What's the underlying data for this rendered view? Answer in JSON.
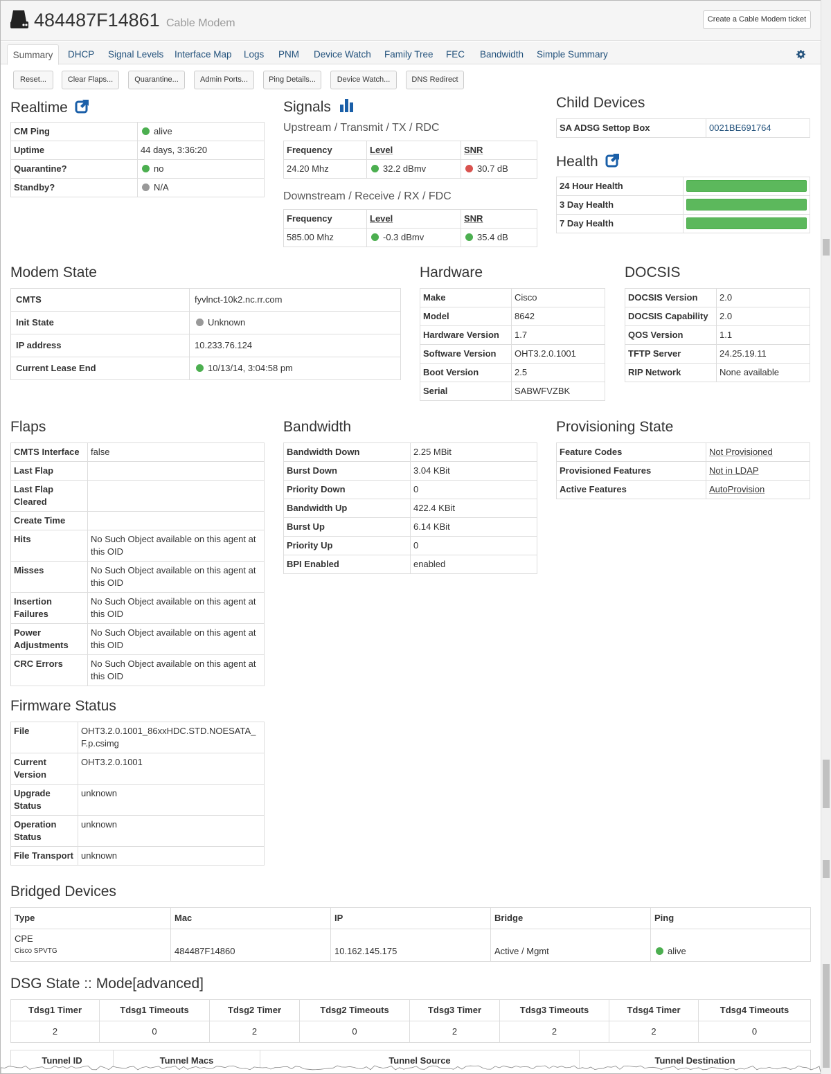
{
  "header": {
    "device_id": "484487F14861",
    "device_type": "Cable Modem",
    "ticket_button": "Create a Cable Modem ticket"
  },
  "tabs": [
    "Summary",
    "DHCP",
    "Signal Levels",
    "Interface Map",
    "Logs",
    "PNM",
    "Device Watch",
    "Family Tree",
    "FEC",
    "Bandwidth",
    "Simple Summary"
  ],
  "actions": [
    "Reset...",
    "Clear Flaps...",
    "Quarantine...",
    "Admin Ports...",
    "Ping Details...",
    "Device Watch...",
    "DNS Redirect"
  ],
  "realtime": {
    "title": "Realtime",
    "rows": [
      [
        "CM Ping",
        "alive"
      ],
      [
        "Uptime",
        "44 days, 3:36:20"
      ],
      [
        "Quarantine?",
        "no"
      ],
      [
        "Standby?",
        "N/A"
      ]
    ]
  },
  "signals": {
    "title": "Signals",
    "upstream_title": "Upstream / Transmit / TX / RDC",
    "downstream_title": "Downstream / Receive / RX / FDC",
    "cols": [
      "Frequency",
      "Level",
      "SNR"
    ],
    "up": [
      "24.20 Mhz",
      "32.2 dBmv",
      "30.7 dB"
    ],
    "down": [
      "585.00 Mhz",
      "-0.3 dBmv",
      "35.4 dB"
    ]
  },
  "child_devices": {
    "title": "Child Devices",
    "rows": [
      [
        "SA ADSG Settop Box",
        "0021BE691764"
      ]
    ]
  },
  "health": {
    "title": "Health",
    "rows": [
      {
        "label": "24 Hour Health",
        "pct": 100
      },
      {
        "label": "3 Day Health",
        "pct": 100
      },
      {
        "label": "7 Day Health",
        "pct": 100
      }
    ]
  },
  "modem_state": {
    "title": "Modem State",
    "rows": [
      [
        "CMTS",
        "fyvlnct-10k2.nc.rr.com"
      ],
      [
        "Init State",
        "Unknown"
      ],
      [
        "IP address",
        "10.233.76.124"
      ],
      [
        "Current Lease End",
        "10/13/14, 3:04:58 pm"
      ]
    ]
  },
  "hardware": {
    "title": "Hardware",
    "rows": [
      [
        "Make",
        "Cisco"
      ],
      [
        "Model",
        "8642"
      ],
      [
        "Hardware Version",
        "1.7"
      ],
      [
        "Software Version",
        "OHT3.2.0.1001"
      ],
      [
        "Boot Version",
        "2.5"
      ],
      [
        "Serial",
        "SABWFVZBK"
      ]
    ]
  },
  "docsis": {
    "title": "DOCSIS",
    "rows": [
      [
        "DOCSIS Version",
        "2.0"
      ],
      [
        "DOCSIS Capability",
        "2.0"
      ],
      [
        "QOS Version",
        "1.1"
      ],
      [
        "TFTP Server",
        "24.25.19.11"
      ],
      [
        "RIP Network",
        "None available"
      ]
    ]
  },
  "flaps": {
    "title": "Flaps",
    "rows": [
      [
        "CMTS Interface",
        "false"
      ],
      [
        "Last Flap",
        ""
      ],
      [
        "Last Flap Cleared",
        ""
      ],
      [
        "Create Time",
        ""
      ],
      [
        "Hits",
        "No Such Object available on this agent at this OID"
      ],
      [
        "Misses",
        "No Such Object available on this agent at this OID"
      ],
      [
        "Insertion Failures",
        "No Such Object available on this agent at this OID"
      ],
      [
        "Power Adjustments",
        "No Such Object available on this agent at this OID"
      ],
      [
        "CRC Errors",
        "No Such Object available on this agent at this OID"
      ]
    ]
  },
  "bandwidth": {
    "title": "Bandwidth",
    "rows": [
      [
        "Bandwidth Down",
        "2.25 MBit"
      ],
      [
        "Burst Down",
        "3.04 KBit"
      ],
      [
        "Priority Down",
        "0"
      ],
      [
        "Bandwidth Up",
        "422.4 KBit"
      ],
      [
        "Burst Up",
        "6.14 KBit"
      ],
      [
        "Priority Up",
        "0"
      ],
      [
        "BPI Enabled",
        "enabled"
      ]
    ]
  },
  "provisioning": {
    "title": "Provisioning State",
    "rows": [
      [
        "Feature Codes",
        "Not Provisioned"
      ],
      [
        "Provisioned Features",
        "Not in LDAP"
      ],
      [
        "Active Features",
        "AutoProvision"
      ]
    ]
  },
  "firmware": {
    "title": "Firmware Status",
    "rows": [
      [
        "File",
        "OHT3.2.0.1001_86xxHDC.STD.NOESATA_F.p.csimg"
      ],
      [
        "Current Version",
        "OHT3.2.0.1001"
      ],
      [
        "Upgrade Status",
        "unknown"
      ],
      [
        "Operation Status",
        "unknown"
      ],
      [
        "File Transport",
        "unknown"
      ]
    ]
  },
  "bridged": {
    "title": "Bridged Devices",
    "cols": [
      "Type",
      "Mac",
      "IP",
      "Bridge",
      "Ping"
    ],
    "rows": [
      {
        "type": "CPE",
        "vendor": "Cisco SPVTG",
        "mac": "484487F14860",
        "ip": "10.162.145.175",
        "bridge": "Active / Mgmt",
        "ping": "alive"
      }
    ]
  },
  "dsg": {
    "title": "DSG State :: Mode[advanced]",
    "cols": [
      "Tdsg1 Timer",
      "Tdsg1 Timeouts",
      "Tdsg2 Timer",
      "Tdsg2 Timeouts",
      "Tdsg3 Timer",
      "Tdsg3 Timeouts",
      "Tdsg4 Timer",
      "Tdsg4 Timeouts"
    ],
    "values": [
      "2",
      "0",
      "2",
      "0",
      "2",
      "2",
      "2",
      "0"
    ],
    "tunnel_cols": [
      "Tunnel ID",
      "Tunnel Macs",
      "Tunnel Source",
      "Tunnel Destination"
    ]
  },
  "colors": {
    "link": "#23527c",
    "ok": "#4caf50",
    "bad": "#d9534f",
    "unknown": "#999999"
  }
}
